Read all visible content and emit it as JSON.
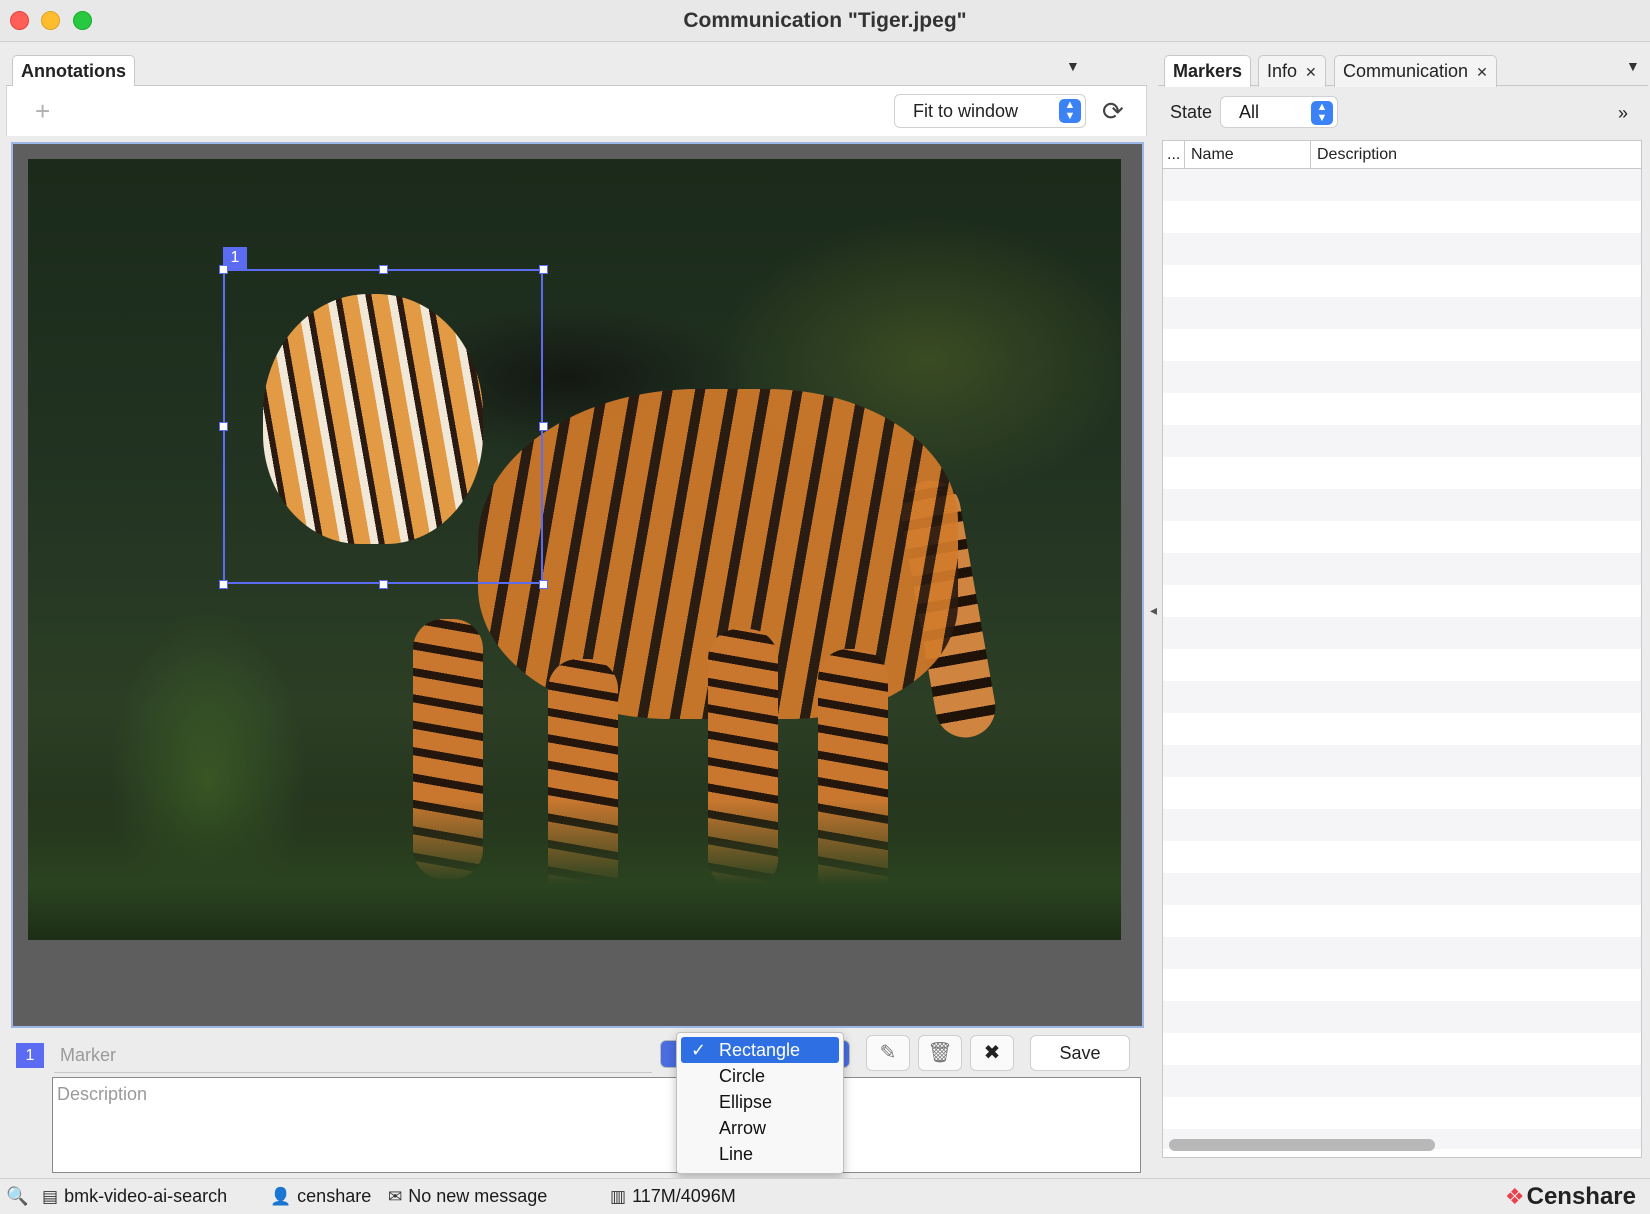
{
  "window": {
    "title": "Communication \"Tiger.jpeg\""
  },
  "left_panel": {
    "tabs": [
      {
        "label": "Annotations",
        "active": true
      }
    ],
    "toolbar": {
      "add_icon": "plus-icon",
      "zoom_value": "Fit to window",
      "refresh_icon": "refresh-icon"
    },
    "canvas": {
      "marker_number": "1",
      "shape": "Rectangle"
    },
    "editor": {
      "marker_number": "1",
      "marker_placeholder": "Marker",
      "description_placeholder": "Description",
      "save_label": "Save",
      "icons": [
        "pencil-icon",
        "trash-icon",
        "close-icon"
      ]
    },
    "shape_menu": {
      "selected": "Rectangle",
      "check": "✓",
      "options": [
        "Rectangle",
        "Circle",
        "Ellipse",
        "Arrow",
        "Line"
      ]
    }
  },
  "right_panel": {
    "tabs": [
      {
        "label": "Markers",
        "active": true,
        "closable": false
      },
      {
        "label": "Info",
        "active": false,
        "closable": true
      },
      {
        "label": "Communication",
        "active": false,
        "closable": true
      }
    ],
    "state_label": "State",
    "state_value": "All",
    "more": "»",
    "table": {
      "columns": [
        "...",
        "Name",
        "Description"
      ]
    }
  },
  "statusbar": {
    "server": "bmk-video-ai-search",
    "user": "censhare",
    "messages": "No new message",
    "memory": "117M/4096M",
    "brand": "Censhare"
  },
  "colors": {
    "accent": "#5b6cf2",
    "selection": "#2f6fe4"
  }
}
